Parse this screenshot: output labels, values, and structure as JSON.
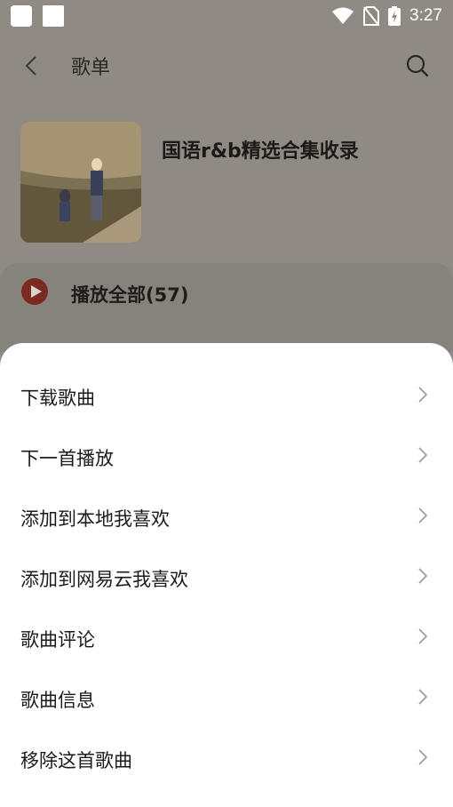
{
  "status_bar": {
    "time": "3:27",
    "icons": [
      "notification-icon",
      "notification-icon",
      "wifi-icon",
      "no-sim-icon",
      "battery-charging-icon"
    ]
  },
  "header": {
    "title": "歌单",
    "back_icon": "chevron-left-icon",
    "search_icon": "search-icon"
  },
  "playlist": {
    "name": "国语r&b精选合集收录"
  },
  "play_all": {
    "label": "播放全部(57)",
    "accent": "#b0271d"
  },
  "sheet": {
    "items": [
      {
        "label": "下载歌曲"
      },
      {
        "label": "下一首播放"
      },
      {
        "label": "添加到本地我喜欢"
      },
      {
        "label": "添加到网易云我喜欢"
      },
      {
        "label": "歌曲评论"
      },
      {
        "label": "歌曲信息"
      },
      {
        "label": "移除这首歌曲"
      }
    ]
  }
}
